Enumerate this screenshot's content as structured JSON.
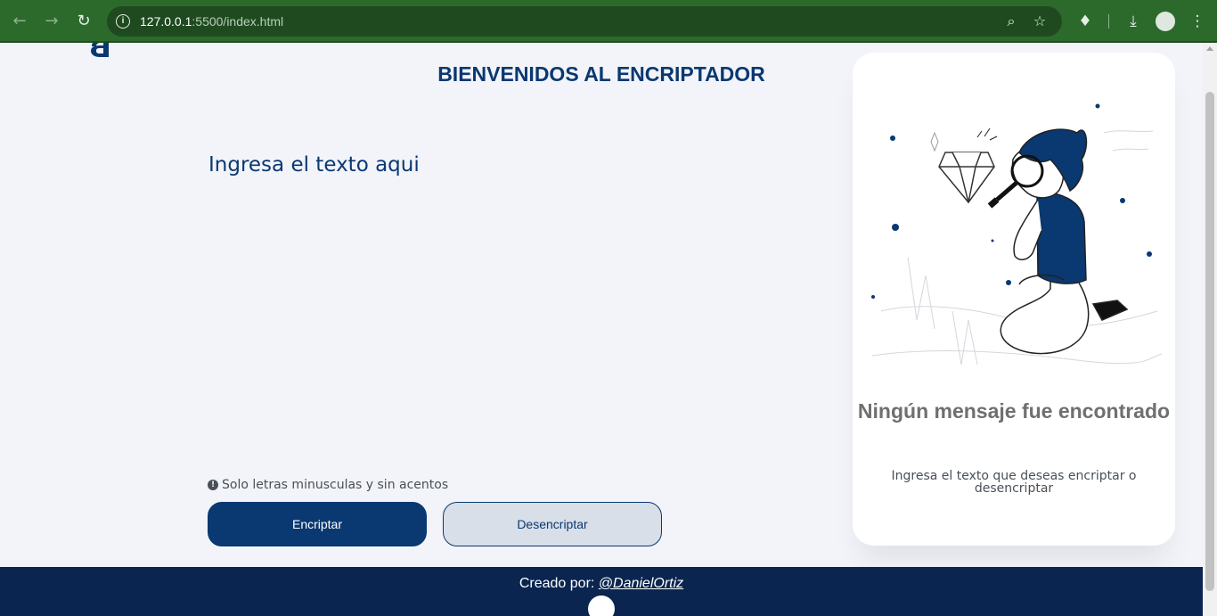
{
  "browser": {
    "url_host": "127.0.0.1",
    "url_rest": ":5500/index.html",
    "icons": [
      "back-icon",
      "forward-icon",
      "reload-icon",
      "site-info-icon",
      "zoom-icon",
      "bookmark-star-icon",
      "extensions-icon",
      "download-icon",
      "profile-avatar",
      "menu-icon"
    ]
  },
  "header": {
    "title": "BIENVENIDOS AL ENCRIPTADOR"
  },
  "input": {
    "placeholder": "Ingresa el texto aqui"
  },
  "hint": {
    "text": "Solo letras minusculas y sin acentos"
  },
  "buttons": {
    "encrypt": "Encriptar",
    "decrypt": "Desencriptar"
  },
  "result_card": {
    "title": "Ningún mensaje fue encontrado",
    "text": "Ingresa el texto que deseas encriptar o desencriptar"
  },
  "footer": {
    "prefix": "Creado por: ",
    "author": "@DanielOrtiz"
  },
  "colors": {
    "primary": "#0a3871",
    "background": "#f2f4f9",
    "footer": "#0a2550",
    "browser_frame": "#2c6a2c"
  }
}
